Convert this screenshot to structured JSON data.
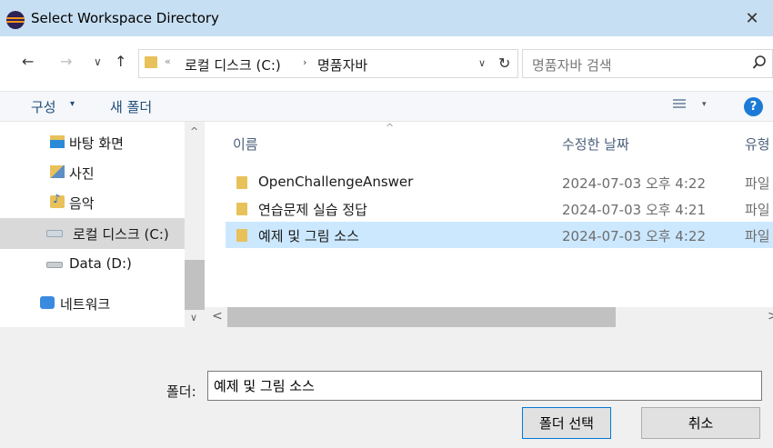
{
  "window": {
    "title": "Select Workspace Directory",
    "close_glyph": "✕"
  },
  "nav": {
    "back_glyph": "←",
    "forward_glyph": "→",
    "recent_glyph": "∨",
    "up_glyph": "↑"
  },
  "address": {
    "overflow_glyph": "«",
    "crumbs": [
      "로컬 디스크 (C:)",
      "명품자바"
    ],
    "separator_glyph": "›",
    "dropdown_glyph": "∨",
    "refresh_glyph": "↻"
  },
  "search": {
    "placeholder": "명품자바 검색",
    "icon_glyph": "⚲"
  },
  "toolbar": {
    "organize_label": "구성",
    "organize_arrow": "▾",
    "new_folder_label": "새 폴더",
    "view_arrow": "▾",
    "help_label": "?"
  },
  "sidebar": {
    "items": [
      {
        "label": "바탕 화면",
        "icon": "desktop-folder-icon"
      },
      {
        "label": "사진",
        "icon": "pictures-folder-icon"
      },
      {
        "label": "음악",
        "icon": "music-folder-icon"
      },
      {
        "label": "로컬 디스크 (C:)",
        "icon": "local-disk-icon",
        "selected": true
      },
      {
        "label": "Data (D:)",
        "icon": "drive-icon"
      },
      {
        "label": "네트워크",
        "icon": "network-icon"
      }
    ],
    "scroll_up_glyph": "^",
    "scroll_down_glyph": "∨"
  },
  "filelist": {
    "columns": {
      "name": "이름",
      "date": "수정한 날짜",
      "type": "유형"
    },
    "sort_glyph": "^",
    "rows": [
      {
        "name": "OpenChallengeAnswer",
        "date": "2024-07-03 오후 4:22",
        "type": "파일"
      },
      {
        "name": "연습문제 실습 정답",
        "date": "2024-07-03 오후 4:21",
        "type": "파일"
      },
      {
        "name": "예제 및 그림 소스",
        "date": "2024-07-03 오후 4:22",
        "type": "파일",
        "selected": true
      }
    ],
    "hscroll_left_glyph": "<",
    "hscroll_right_glyph": ">"
  },
  "footer": {
    "folder_label": "폴더:",
    "folder_value": "예제 및 그림 소스",
    "select_button": "폴더 선택",
    "cancel_button": "취소"
  },
  "colors": {
    "titlebar": "#c7dff2",
    "selection": "#cce8ff",
    "accent": "#0078d7"
  }
}
